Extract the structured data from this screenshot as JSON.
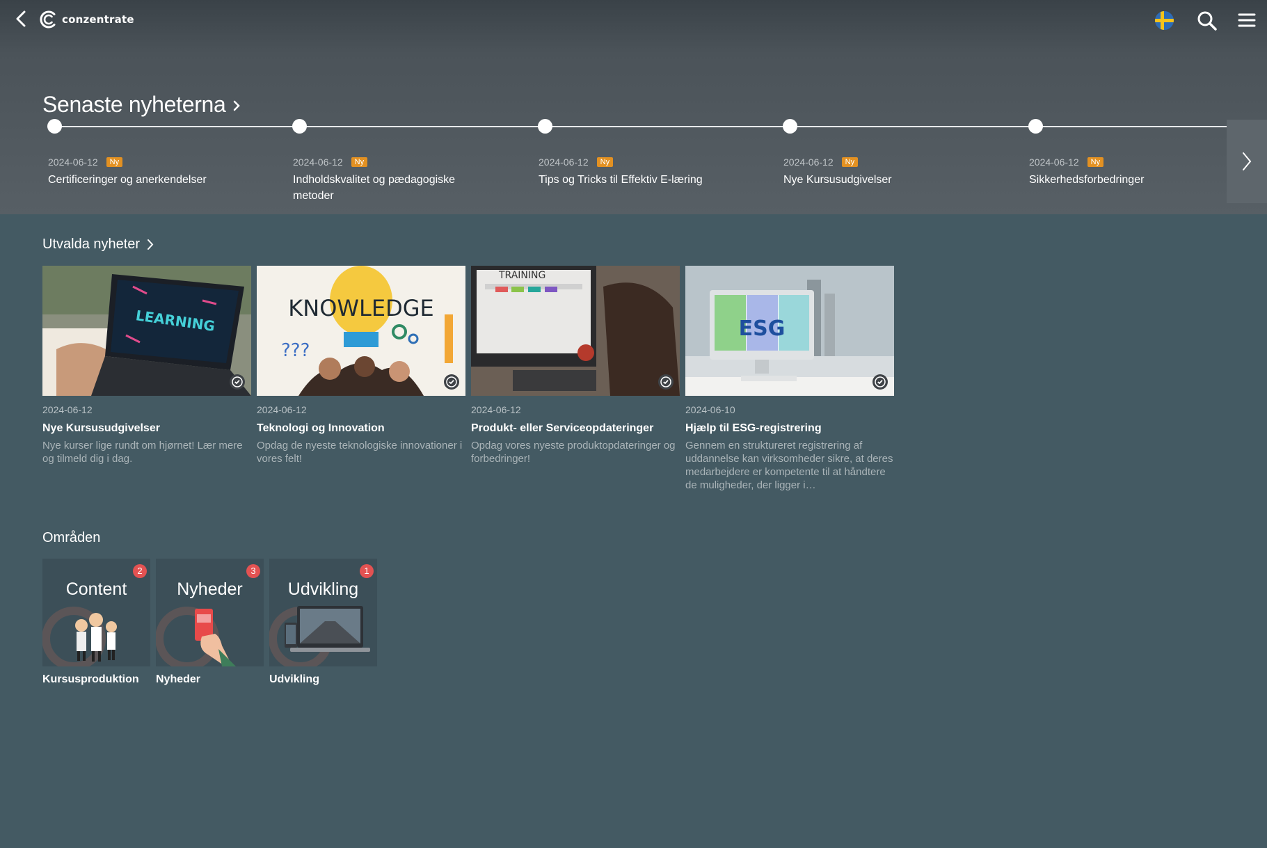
{
  "app": {
    "logo_text": "conzentrate"
  },
  "latest_news": {
    "title": "Senaste nyheterna",
    "items": [
      {
        "date": "2024-06-12",
        "badge": "Ny",
        "title": "Certificeringer og anerkendelser"
      },
      {
        "date": "2024-06-12",
        "badge": "Ny",
        "title": "Indholdskvalitet og pædagogiske metoder"
      },
      {
        "date": "2024-06-12",
        "badge": "Ny",
        "title": "Tips og Tricks til Effektiv E-læring"
      },
      {
        "date": "2024-06-12",
        "badge": "Ny",
        "title": "Nye Kursusudgivelser"
      },
      {
        "date": "2024-06-12",
        "badge": "Ny",
        "title": "Sikkerhedsforbedringer"
      }
    ]
  },
  "featured": {
    "title": "Utvalda nyheter",
    "cards": [
      {
        "date": "2024-06-12",
        "title": "Nye Kursusudgivelser",
        "desc": "Nye kurser lige rundt om hjørnet! Lær mere og tilmeld dig i dag.",
        "image_text": "LEARNING"
      },
      {
        "date": "2024-06-12",
        "title": "Teknologi og Innovation",
        "desc": "Opdag de nyeste teknologiske innovationer i vores felt!",
        "image_text": "KNOWLEDGE"
      },
      {
        "date": "2024-06-12",
        "title": "Produkt- eller Serviceopdateringer",
        "desc": "Opdag vores nyeste produktopdateringer og forbedringer!",
        "image_text": "TRAINING"
      },
      {
        "date": "2024-06-10",
        "title": "Hjælp til ESG-registrering",
        "desc": "Gennem en struktureret registrering af uddannelse kan virksomheder sikre, at deres medarbejdere er kompetente til at håndtere de muligheder, der ligger i…",
        "image_text": "ESG"
      }
    ]
  },
  "areas": {
    "title": "Områden",
    "items": [
      {
        "word": "Content",
        "count": "2",
        "label": "Kursusproduktion"
      },
      {
        "word": "Nyheder",
        "count": "3",
        "label": "Nyheder"
      },
      {
        "word": "Udvikling",
        "count": "1",
        "label": "Udvikling"
      }
    ]
  },
  "colors": {
    "accent_badge": "#e39122",
    "count_badge": "#e35252",
    "background": "#445a63"
  }
}
